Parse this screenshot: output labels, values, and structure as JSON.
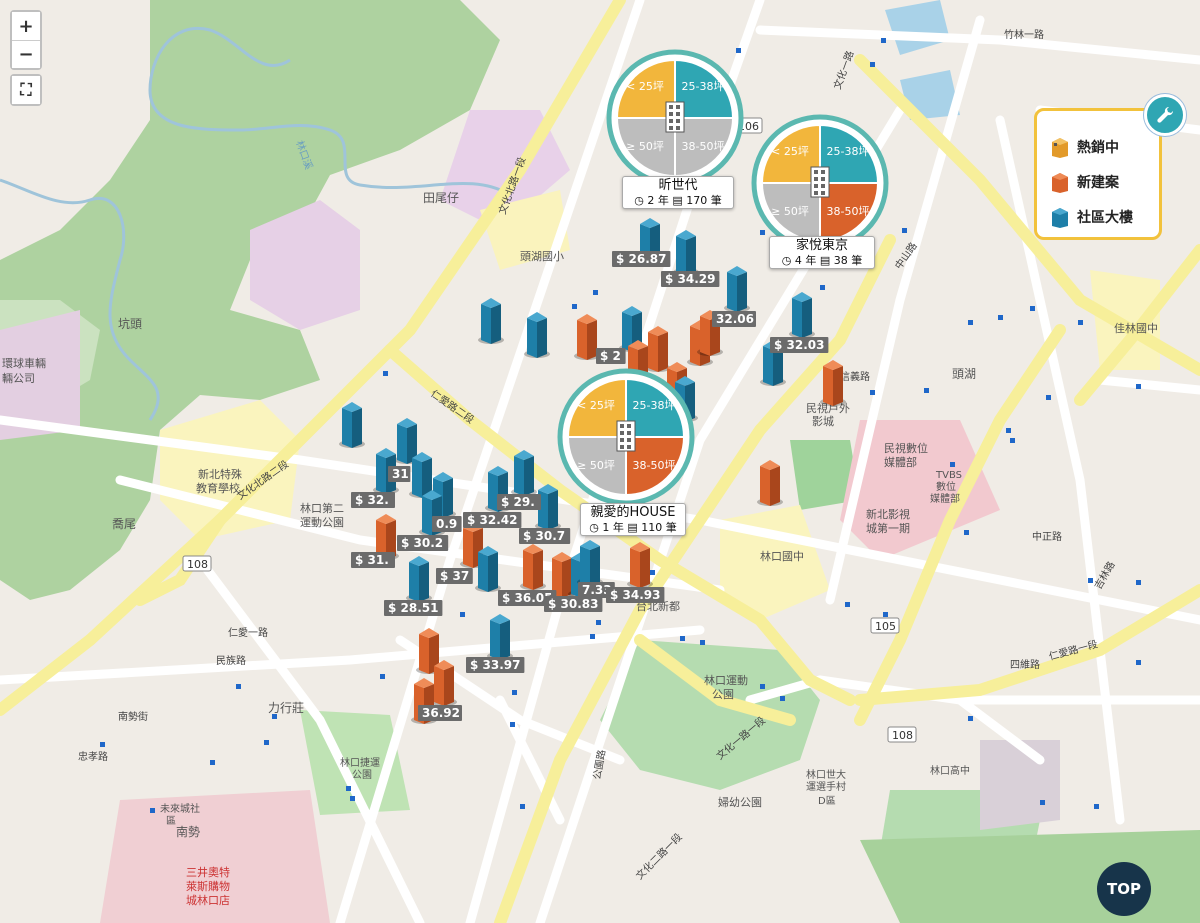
{
  "controls": {
    "zoom_in": "+",
    "zoom_out": "−",
    "fullscreen": "⛶"
  },
  "legend": {
    "items": [
      {
        "label": "熱銷中",
        "color": "#e29a2a"
      },
      {
        "label": "新建案",
        "color": "#d9622b"
      },
      {
        "label": "社區大樓",
        "color": "#1e7fa8"
      }
    ]
  },
  "top_button": "TOP",
  "colors": {
    "pie_yellow": "#f2b63c",
    "pie_teal": "#2fa6b3",
    "pie_gray": "#bdbdbd",
    "pie_orange": "#d9622b",
    "blue": "#1e7fa8",
    "orange": "#d9622b"
  },
  "projects": [
    {
      "name": "昕世代",
      "meta": "◷ 2 年 ▤ 170 筆",
      "q1": "< 25坪",
      "q2": "25-38坪",
      "q3": "≥ 50坪",
      "q4": "38-50坪",
      "q3fill": "#bdbdbd",
      "q4fill": "#bdbdbd",
      "q2fill": "#2fa6b3",
      "q1fill": "#f2b63c"
    },
    {
      "name": "家悅東京",
      "meta": "◷ 4 年 ▤ 38 筆",
      "q1": "< 25坪",
      "q2": "25-38坪",
      "q3": "≥ 50坪",
      "q4": "38-50坪",
      "q3fill": "#bdbdbd",
      "q4fill": "#d9622b",
      "q2fill": "#2fa6b3",
      "q1fill": "#f2b63c"
    },
    {
      "name": "親愛的HOUSE",
      "meta": "◷ 1 年 ▤ 110 筆",
      "q1": "< 25坪",
      "q2": "25-38坪",
      "q3": "≥ 50坪",
      "q4": "38-50坪",
      "q3fill": "#bdbdbd",
      "q4fill": "#d9622b",
      "q2fill": "#2fa6b3",
      "q1fill": "#f2b63c"
    }
  ],
  "prices": [
    "$ 26.87",
    "$ 34.29",
    "32.06",
    "$ 32.03",
    "$ 2",
    "$ 32.",
    "$ 29.",
    "$ 32.42",
    "$ 30.2",
    "0.9",
    "$ 30.7",
    "$ 31.",
    "$ 37",
    "$ 28.51",
    "$ 36.05",
    "$ 30.83",
    "7.33",
    "$ 34.93",
    "$ 33.97",
    "36.92",
    "31"
  ],
  "map_labels": {
    "tianweizai": "田尾仔",
    "toulin_school": "頭湖國小",
    "kengtou": "坑頭",
    "huanqiu": "環球車輛",
    "huanqiu2": "輛公司",
    "xinbei_edu": "新北特殊",
    "xinbei_edu2": "教育學校",
    "park2": "林口第二",
    "park2b": "運動公園",
    "qiaowei": "喬尾",
    "lixing": "力行莊",
    "nanshi": "南勢",
    "linkou_park": "林口運動",
    "linkou_park2": "公園",
    "linkou_mid": "林口國中",
    "minshi": "民視戶外",
    "minshi2": "影城",
    "minshi_lab": "民視數位",
    "minshi_lab2": "媒體部",
    "tvbs": "TVBS",
    "tvbs2": "數位",
    "tvbs3": "媒體部",
    "xinbei_film": "新北影視",
    "xinbei_film2": "城第一期",
    "toulin": "頭湖",
    "jialin": "佳林國中",
    "linkou_high": "林口高中",
    "taibei_new": "台北新都",
    "fuyou": "婦幼公園",
    "mitsui": "三井奧特",
    "mitsui2": "萊斯購物",
    "mitsui3": "城林口店",
    "weilai": "未來城社",
    "weilai2": "區",
    "linkou_rail": "林口捷運",
    "linkou_rail2": "公園",
    "linkou_hs_center": "林口世大",
    "linkou_hs2": "運選手村",
    "linkou_hs3": "D區",
    "r_wenhua1": "文化一路",
    "r_wenhua2": "文化二路一段",
    "r_wenhua_n": "文化北路一段",
    "r_wenhua_n2": "文化北路二段",
    "r_renai": "仁愛路二段",
    "r_renai1": "仁愛路一段",
    "r_zhongshan": "中山路",
    "r_xinyi": "信義路",
    "r_zhongzheng": "中正路",
    "r_jili": "吉林路",
    "r_sixwei": "四維路",
    "r_nanshijie": "南勢街",
    "r_zhongxiao": "忠孝路",
    "r_gongyuan": "公園路",
    "r_minfu": "民族路",
    "r_renai_st": "仁愛一路",
    "r_wenhua1b": "文化一路一段",
    "r_zhufu": "竹林一路",
    "road108": "108",
    "road105": "105",
    "road106": "106",
    "linkou_creek": "林口溪",
    "wenhua_one": "文化一路"
  }
}
